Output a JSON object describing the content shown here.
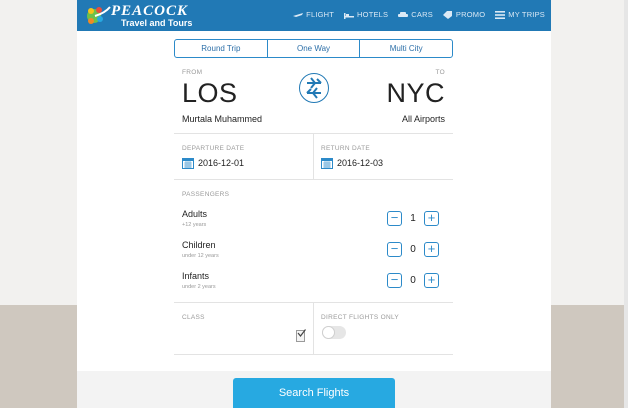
{
  "brand": {
    "name": "PEACOCK",
    "tagline": "Travel and Tours"
  },
  "nav": [
    {
      "label": "FLIGHT",
      "icon": "plane-icon"
    },
    {
      "label": "HOTELS",
      "icon": "bed-icon"
    },
    {
      "label": "CARS",
      "icon": "car-icon"
    },
    {
      "label": "PROMO",
      "icon": "tag-icon"
    },
    {
      "label": "MY TRIPS",
      "icon": "list-icon"
    }
  ],
  "trip_tabs": [
    "Round Trip",
    "One Way",
    "Multi City"
  ],
  "route": {
    "from_label": "FROM",
    "to_label": "TO",
    "from_code": "LOS",
    "to_code": "NYC",
    "from_city": "Murtala Muhammed",
    "to_city": "All Airports"
  },
  "dates": {
    "departure_label": "DEPARTURE DATE",
    "departure_value": "2016-12-01",
    "return_label": "RETURN DATE",
    "return_value": "2016-12-03"
  },
  "passengers": {
    "label": "PASSENGERS",
    "items": [
      {
        "name": "Adults",
        "sub": "+12 years",
        "count": "1"
      },
      {
        "name": "Children",
        "sub": "under 12 years",
        "count": "0"
      },
      {
        "name": "Infants",
        "sub": "under 2 years",
        "count": "0"
      }
    ]
  },
  "options": {
    "class_label": "CLASS",
    "direct_label": "DIRECT FLIGHTS ONLY",
    "direct_on": false
  },
  "search_button": "Search Flights",
  "colors": {
    "brand_blue": "#2179b5",
    "accent": "#27a9e1"
  }
}
